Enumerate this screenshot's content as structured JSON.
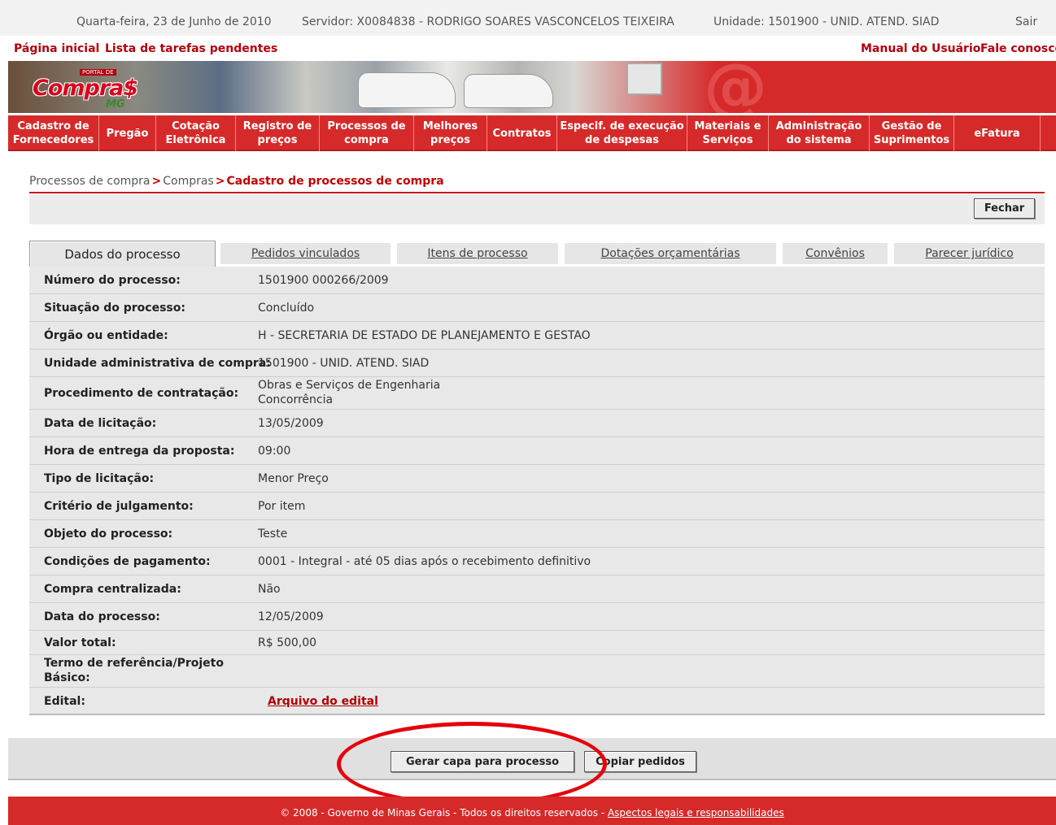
{
  "topbar": {
    "date": "Quarta-feira, 23 de Junho de 2010",
    "server": "Servidor: X0084838 - RODRIGO SOARES VASCONCELOS TEIXEIRA",
    "unit": "Unidade: 1501900 - UNID. ATEND. SIAD",
    "logout": "Sair"
  },
  "links": {
    "home": "Página inicial",
    "tasks": "Lista de tarefas pendentes",
    "manual": "Manual do Usuário",
    "contact": "Fale conosco"
  },
  "logo": {
    "portal": "PORTAL DE",
    "word": "Compra$",
    "state": "MG"
  },
  "menu": [
    "Cadastro de\nFornecedores",
    "Pregão",
    "Cotação\nEletrônica",
    "Registro de\npreços",
    "Processos de\ncompra",
    "Melhores\npreços",
    "Contratos",
    "Especif. de execução\nde despesas",
    "Materiais e\nServiços",
    "Administração\ndo sistema",
    "Gestão de\nSuprimentos",
    "eFatura"
  ],
  "breadcrumb": {
    "level1": "Processos de compra",
    "level2": "Compras",
    "current": "Cadastro de processos de compra",
    "separator": ">"
  },
  "actions": {
    "close": "Fechar"
  },
  "tabs": [
    "Dados do processo",
    "Pedidos vinculados",
    "Itens de processo",
    "Dotações orçamentárias",
    "Convênios",
    "Parecer jurídico"
  ],
  "fields": [
    {
      "label": "Número do processo:",
      "value": "1501900 000266/2009"
    },
    {
      "label": "Situação do processo:",
      "value": "Concluído"
    },
    {
      "label": "Órgão ou entidade:",
      "value": "H - SECRETARIA DE ESTADO DE PLANEJAMENTO E GESTAO"
    },
    {
      "label": "Unidade administrativa de compra:",
      "value": "1501900 - UNID. ATEND. SIAD"
    },
    {
      "label": "Procedimento de contratação:",
      "value": "Obras e Serviços de Engenharia",
      "value2": "Concorrência"
    },
    {
      "label": "Data de licitação:",
      "value": "13/05/2009"
    },
    {
      "label": "Hora de entrega da proposta:",
      "value": "09:00"
    },
    {
      "label": "Tipo de licitação:",
      "value": "Menor Preço"
    },
    {
      "label": "Critério de julgamento:",
      "value": "Por item"
    },
    {
      "label": "Objeto do processo:",
      "value": "Teste"
    },
    {
      "label": "Condições de pagamento:",
      "value": "0001 - Integral - até 05 dias após o recebimento definitivo"
    },
    {
      "label": "Compra centralizada:",
      "value": "Não"
    },
    {
      "label": "Data do processo:",
      "value": "12/05/2009"
    },
    {
      "label": "Valor total:",
      "value": "R$ 500,00"
    },
    {
      "label": "Termo de referência/Projeto",
      "label2": "Básico:",
      "value": ""
    },
    {
      "label": "Edital:",
      "link": "Arquivo do edital"
    }
  ],
  "buttons": {
    "generate_cover": "Gerar capa para processo",
    "copy_orders": "Copiar pedidos"
  },
  "footer": {
    "text": "© 2008 - Governo de Minas Gerais - Todos os direitos reservados - ",
    "link": "Aspectos legais e responsabilidades"
  },
  "colors": {
    "brand_red": "#d62a2a",
    "dark_red": "#b0000a",
    "annotation_circle": "#e5000a"
  }
}
